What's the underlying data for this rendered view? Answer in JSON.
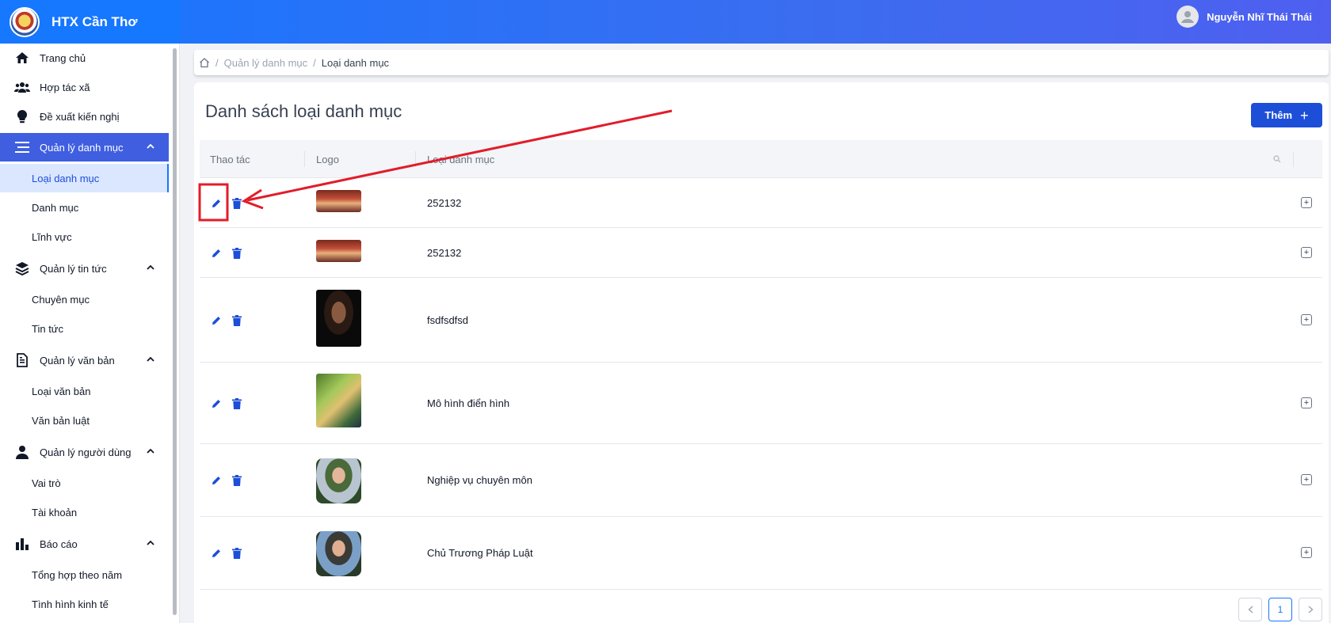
{
  "app": {
    "name": "HTX Cần Thơ",
    "logo_icon": "cooperative-logo-icon"
  },
  "user": {
    "name": "Nguyễn Nhĩ Thái Thái",
    "avatar_icon": "user-avatar-icon"
  },
  "sidebar": {
    "groups": [
      {
        "label": "Trang chủ",
        "icon": "home-icon"
      },
      {
        "label": "Hợp tác xã",
        "icon": "users-icon"
      },
      {
        "label": "Đề xuất kiến nghị",
        "icon": "lightbulb-icon"
      },
      {
        "label": "Quản lý danh mục",
        "icon": "list-icon",
        "active": true,
        "children": [
          "Loại danh mục",
          "Danh mục",
          "Lĩnh vực"
        ]
      },
      {
        "label": "Quản lý tin tức",
        "icon": "layers-icon",
        "children": [
          "Chuyên mục",
          "Tin tức"
        ]
      },
      {
        "label": "Quản lý văn bản",
        "icon": "document-icon",
        "children": [
          "Loại văn bản",
          "Văn bản luật"
        ]
      },
      {
        "label": "Quản lý người dùng",
        "icon": "user-icon",
        "children": [
          "Vai trò",
          "Tài khoản"
        ]
      },
      {
        "label": "Báo cáo",
        "icon": "bar-chart-icon",
        "children": [
          "Tổng hợp theo năm",
          "Tình hình kinh tế"
        ]
      }
    ],
    "selected": "Loại danh mục"
  },
  "breadcrumb": {
    "home_icon": "home-outline-icon",
    "items": [
      "Quản lý danh mục",
      "Loại danh mục"
    ]
  },
  "page": {
    "title": "Danh sách loại danh mục",
    "add_label": "Thêm"
  },
  "table": {
    "columns": [
      "Thao tác",
      "Logo",
      "Loại danh mục"
    ],
    "rows": [
      {
        "label": "252132",
        "logo": "temple-interior-thumbnail"
      },
      {
        "label": "252132",
        "logo": "temple-interior-thumbnail"
      },
      {
        "label": "fsdfsdfsd",
        "logo": "woman-portrait-thumbnail"
      },
      {
        "label": "Mô hình điển hình",
        "logo": "handshake-thumbnail"
      },
      {
        "label": "Nghiệp vụ chuyên môn",
        "logo": "man-portrait-thumbnail"
      },
      {
        "label": "Chủ Trương Pháp Luật",
        "logo": "man-portrait-thumbnail"
      }
    ]
  },
  "pagination": {
    "current": "1"
  },
  "colors": {
    "primary": "#1677ff",
    "active_menu": "#3f5fe0",
    "annotation": "#e11d2a"
  }
}
